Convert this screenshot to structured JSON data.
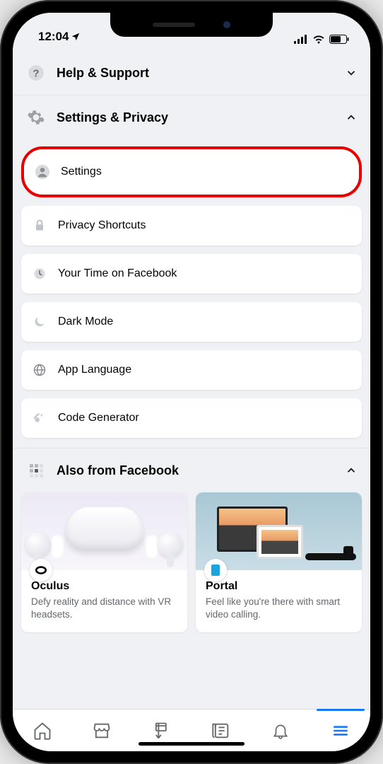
{
  "status": {
    "time": "12:04"
  },
  "sections": {
    "help": {
      "title": "Help & Support",
      "expanded": false
    },
    "settings_privacy": {
      "title": "Settings & Privacy",
      "expanded": true,
      "items": [
        {
          "label": "Settings",
          "icon": "person",
          "highlighted": true
        },
        {
          "label": "Privacy Shortcuts",
          "icon": "lock"
        },
        {
          "label": "Your Time on Facebook",
          "icon": "clock"
        },
        {
          "label": "Dark Mode",
          "icon": "moon"
        },
        {
          "label": "App Language",
          "icon": "globe"
        },
        {
          "label": "Code Generator",
          "icon": "key"
        }
      ]
    },
    "also_from": {
      "title": "Also from Facebook",
      "expanded": true,
      "cards": [
        {
          "name": "Oculus",
          "desc": "Defy reality and distance with VR headsets."
        },
        {
          "name": "Portal",
          "desc": "Feel like you're there with smart video calling."
        }
      ]
    }
  },
  "tabs": [
    "home",
    "marketplace",
    "groups",
    "news",
    "notifications",
    "menu"
  ],
  "active_tab": "menu"
}
